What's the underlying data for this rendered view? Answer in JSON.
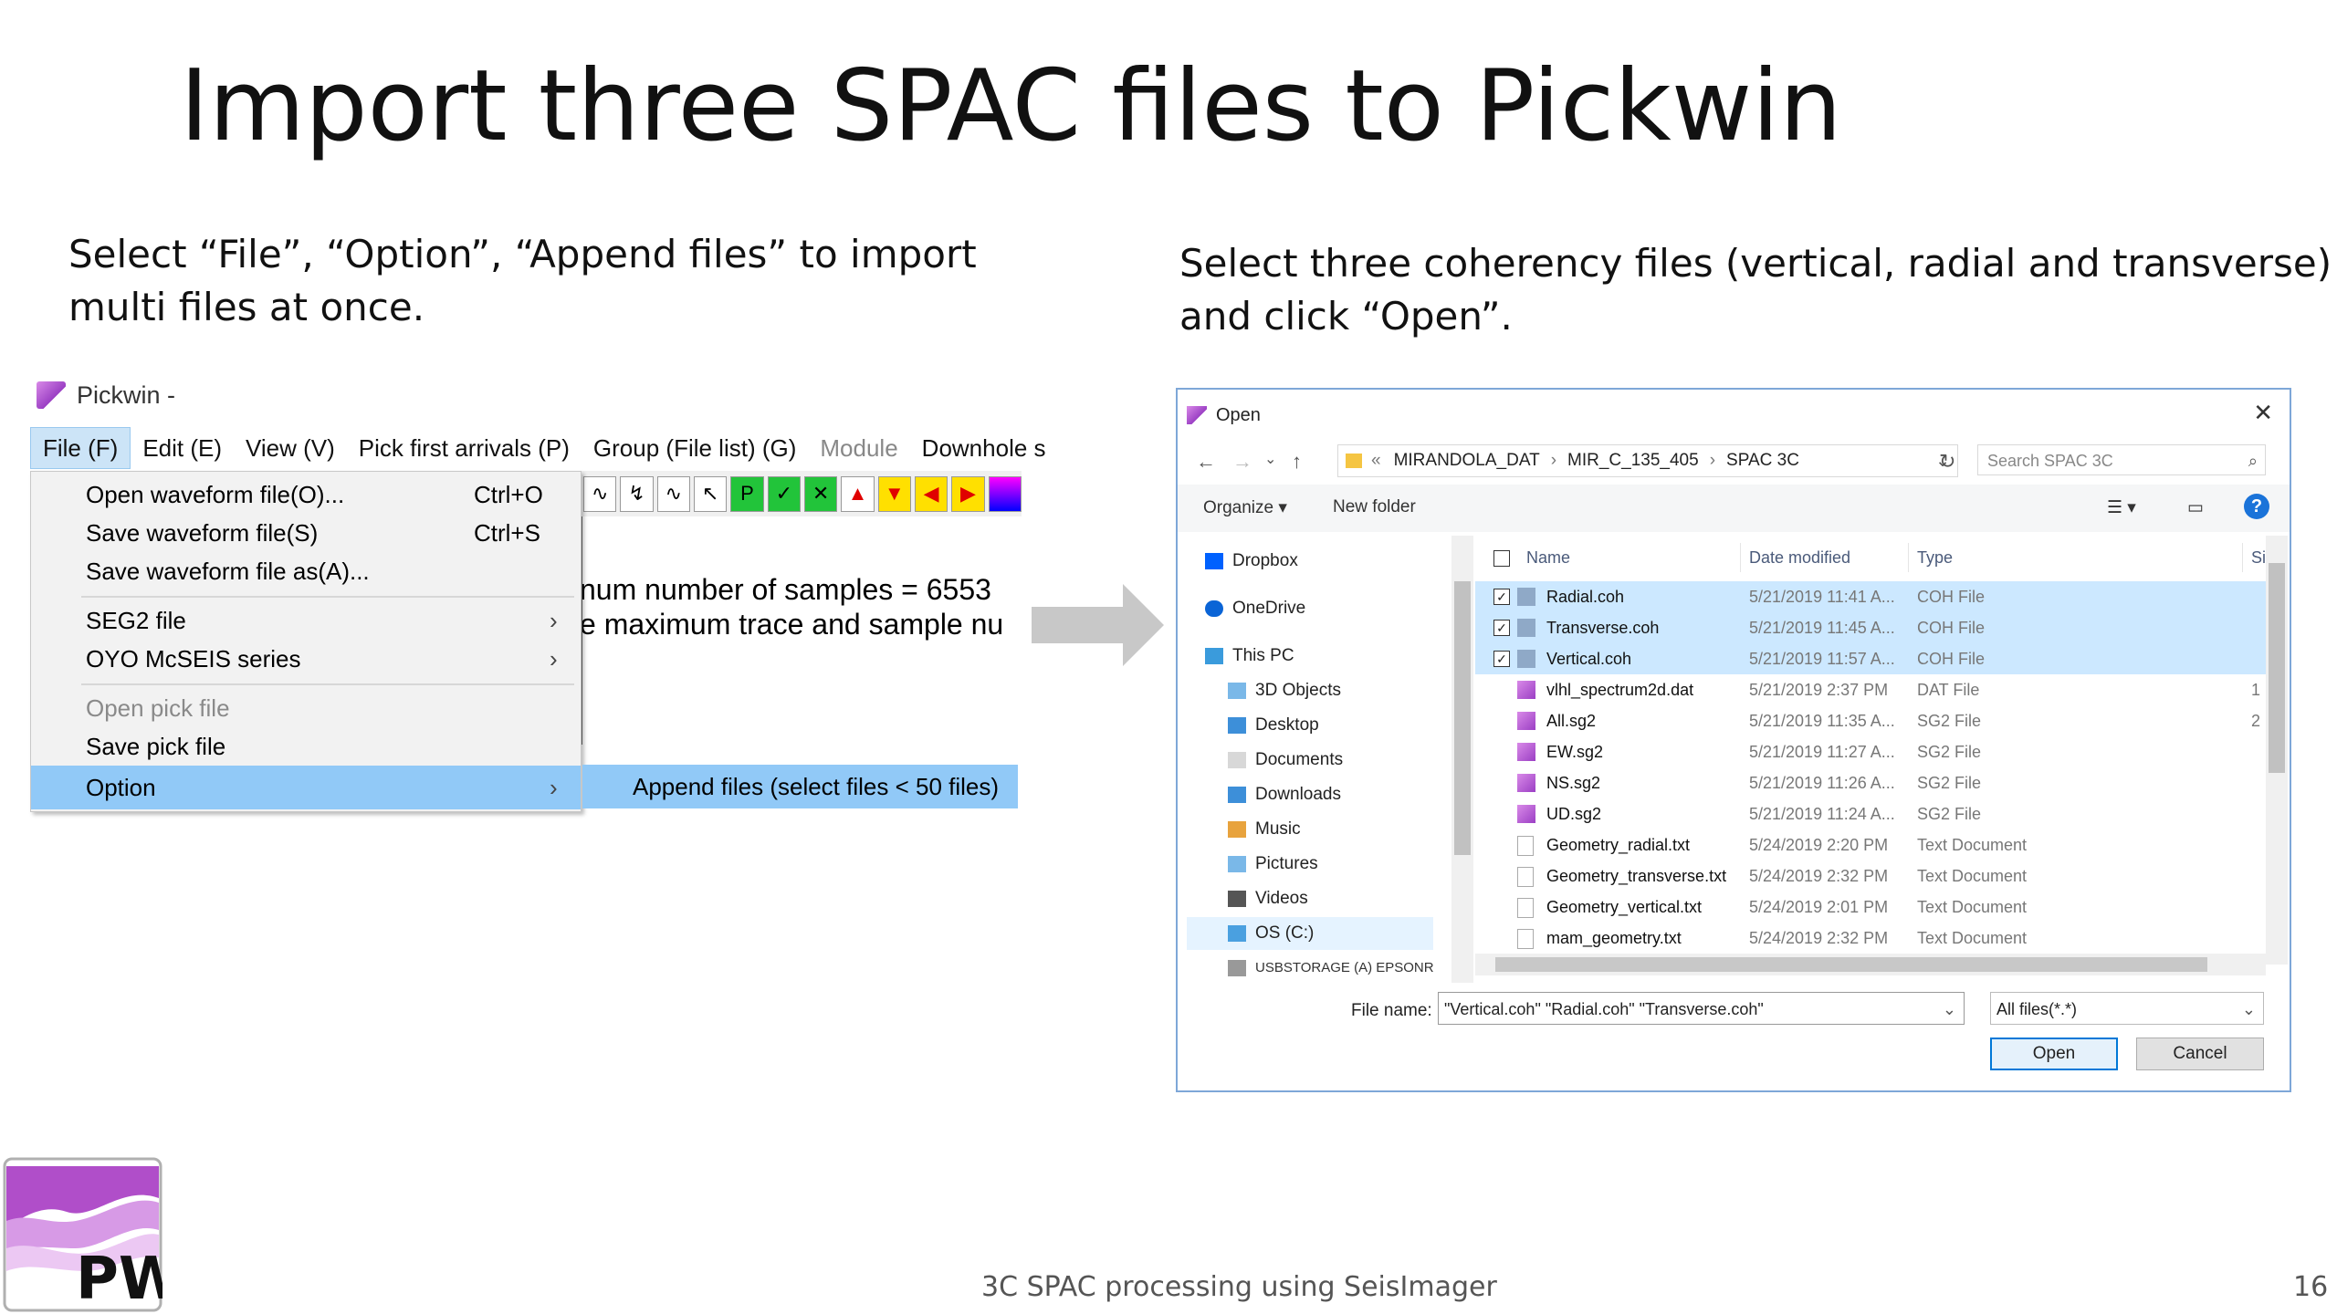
{
  "slide": {
    "title": "Import three SPAC files to Pickwin",
    "caption_left_1": "Select “File”, “Option”, “Append files” to import",
    "caption_left_2": "multi files at once.",
    "caption_right_1": "Select three coherency files (vertical, radial and transverse)",
    "caption_right_2": "and click “Open”.",
    "footer": "3C SPAC processing using SeisImager",
    "page_number": "16",
    "logo_text": "PW"
  },
  "pickwin": {
    "title": "Pickwin -",
    "menu": [
      "File (F)",
      "Edit (E)",
      "View (V)",
      "Pick first arrivals (P)",
      "Group (File list) (G)",
      "Module",
      "Downhole s"
    ],
    "content_line_1": "num number of samples = 6553",
    "content_line_2": "e maximum trace and sample nu",
    "dropdown": {
      "open_waveform": "Open waveform file(O)...",
      "open_waveform_sc": "Ctrl+O",
      "save_waveform": "Save waveform file(S)",
      "save_waveform_sc": "Ctrl+S",
      "save_waveform_as": "Save waveform file as(A)...",
      "seg2": "SEG2 file",
      "oyo": "OYO McSEIS series",
      "open_pick": "Open pick file",
      "save_pick": "Save pick file",
      "option": "Option",
      "arrow": "›"
    },
    "submenu": "Append files (select files < 50 files)"
  },
  "dialog": {
    "title": "Open",
    "path": [
      "MIRANDOLA_DAT",
      "MIR_C_135_405",
      "SPAC 3C"
    ],
    "search_placeholder": "Search SPAC 3C",
    "organize": "Organize ▾",
    "new_folder": "New folder",
    "nav": [
      "Dropbox",
      "OneDrive",
      "This PC",
      "3D Objects",
      "Desktop",
      "Documents",
      "Downloads",
      "Music",
      "Pictures",
      "Videos",
      "OS (C:)",
      "USBSTORAGE (A) EPSONR"
    ],
    "columns": {
      "name": "Name",
      "date": "Date modified",
      "type": "Type",
      "size": "Si:"
    },
    "files": [
      {
        "name": "Radial.coh",
        "date": "5/21/2019 11:41 A...",
        "type": "COH File",
        "size": "",
        "selected": true
      },
      {
        "name": "Transverse.coh",
        "date": "5/21/2019 11:45 A...",
        "type": "COH File",
        "size": "",
        "selected": true
      },
      {
        "name": "Vertical.coh",
        "date": "5/21/2019 11:57 A...",
        "type": "COH File",
        "size": "",
        "selected": true
      },
      {
        "name": "vlhl_spectrum2d.dat",
        "date": "5/21/2019 2:37 PM",
        "type": "DAT File",
        "size": "1",
        "selected": false
      },
      {
        "name": "All.sg2",
        "date": "5/21/2019 11:35 A...",
        "type": "SG2 File",
        "size": "2",
        "selected": false
      },
      {
        "name": "EW.sg2",
        "date": "5/21/2019 11:27 A...",
        "type": "SG2 File",
        "size": "",
        "selected": false
      },
      {
        "name": "NS.sg2",
        "date": "5/21/2019 11:26 A...",
        "type": "SG2 File",
        "size": "",
        "selected": false
      },
      {
        "name": "UD.sg2",
        "date": "5/21/2019 11:24 A...",
        "type": "SG2 File",
        "size": "",
        "selected": false
      },
      {
        "name": "Geometry_radial.txt",
        "date": "5/24/2019 2:20 PM",
        "type": "Text Document",
        "size": "",
        "selected": false
      },
      {
        "name": "Geometry_transverse.txt",
        "date": "5/24/2019 2:32 PM",
        "type": "Text Document",
        "size": "",
        "selected": false
      },
      {
        "name": "Geometry_vertical.txt",
        "date": "5/24/2019 2:01 PM",
        "type": "Text Document",
        "size": "",
        "selected": false
      },
      {
        "name": "mam_geometry.txt",
        "date": "5/24/2019 2:32 PM",
        "type": "Text Document",
        "size": "",
        "selected": false
      }
    ],
    "file_name_label": "File name:",
    "file_name_value": "\"Vertical.coh\" \"Radial.coh\" \"Transverse.coh\"",
    "file_type": "All files(*.*)",
    "open_button": "Open",
    "cancel_button": "Cancel"
  }
}
